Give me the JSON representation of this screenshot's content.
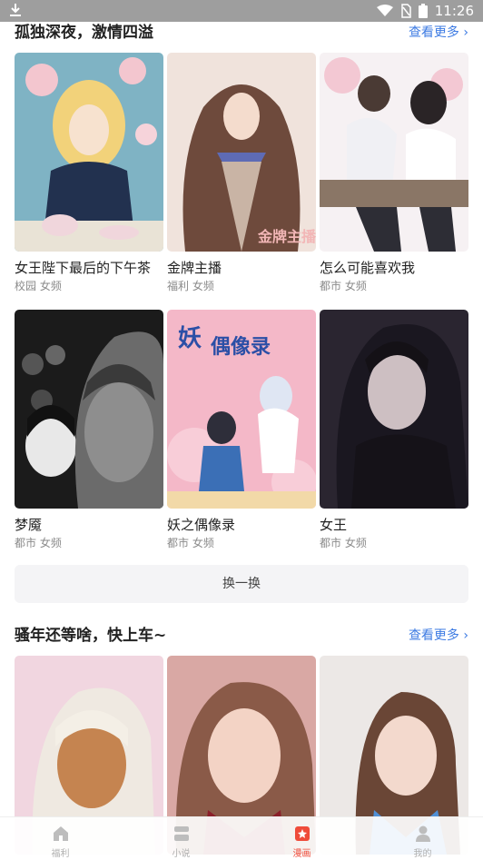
{
  "status_bar": {
    "time": "11:26"
  },
  "section1": {
    "title": "孤独深夜，激情四溢",
    "more": "查看更多 ›",
    "cards": [
      {
        "title": "女王陛下最后的下午茶",
        "tags": "校园 女频"
      },
      {
        "title": "金牌主播",
        "tags": "福利 女频"
      },
      {
        "title": "怎么可能喜欢我",
        "tags": "都市 女频"
      },
      {
        "title": "梦魇",
        "tags": "都市 女频"
      },
      {
        "title": "妖之偶像录",
        "tags": "都市 女频"
      },
      {
        "title": "女王",
        "tags": "都市 女频"
      }
    ],
    "swap_label": "换一换"
  },
  "section2": {
    "title": "骚年还等啥，快上车~",
    "more": "查看更多 ›"
  },
  "bottom_nav": [
    {
      "label": "福利",
      "icon": "home-icon"
    },
    {
      "label": "小说",
      "icon": "book-icon"
    },
    {
      "label": "漫画",
      "icon": "comic-icon"
    },
    {
      "label": "我的",
      "icon": "user-icon"
    }
  ],
  "colors": {
    "accent": "#ef4b3a",
    "link": "#3d7be3"
  }
}
